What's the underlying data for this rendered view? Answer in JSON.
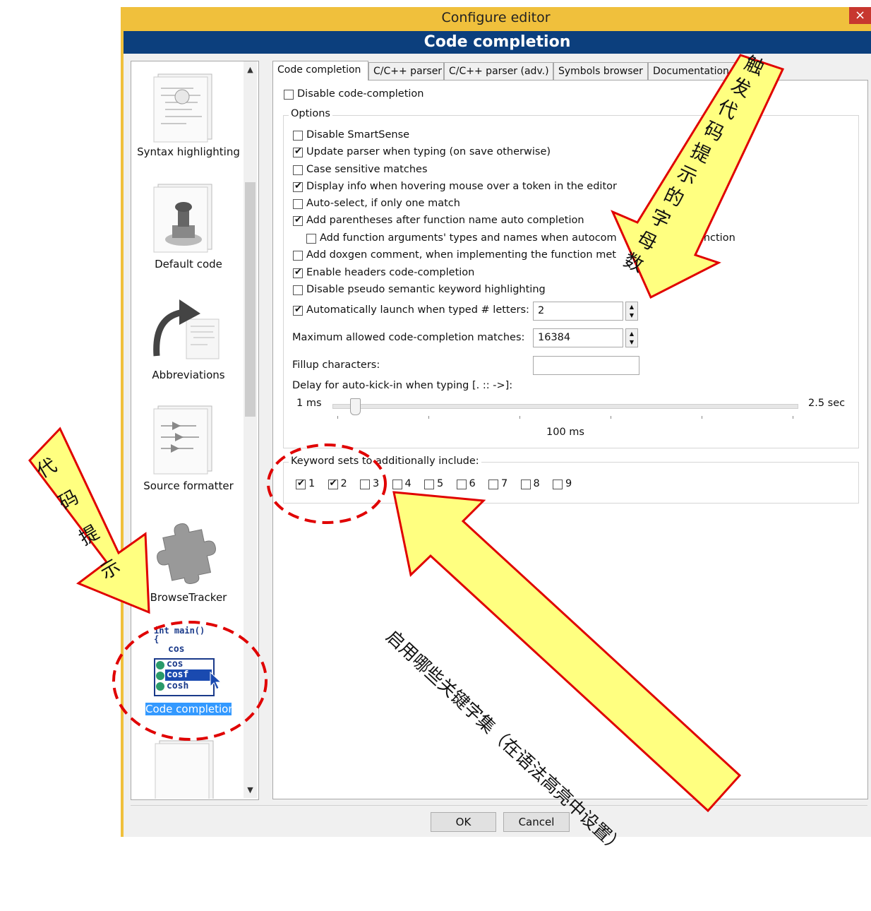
{
  "window": {
    "title": "Configure editor",
    "close_glyph": "×",
    "header": "Code completion"
  },
  "sidebar": {
    "items": [
      {
        "label": "Syntax highlighting",
        "icon": "document-icon"
      },
      {
        "label": "Default code",
        "icon": "stamp-icon"
      },
      {
        "label": "Abbreviations",
        "icon": "curved-arrow-icon"
      },
      {
        "label": "Source formatter",
        "icon": "formatter-icon"
      },
      {
        "label": "BrowseTracker",
        "icon": "puzzle-icon"
      },
      {
        "label": "Code completion",
        "icon": "code-completion-icon",
        "selected": true
      }
    ],
    "code_icon_lines": [
      "int main()",
      "{",
      "cos",
      "cos",
      "cosf",
      "cosh"
    ]
  },
  "tabs": [
    "Code completion",
    "C/C++ parser",
    "C/C++ parser (adv.)",
    "Symbols browser",
    "Documentation"
  ],
  "panel": {
    "disable_cc": {
      "label": "Disable code-completion",
      "checked": false
    },
    "options_title": "Options",
    "options": [
      {
        "label": "Disable SmartSense",
        "checked": false
      },
      {
        "label": "Update parser when typing (on save otherwise)",
        "checked": true
      },
      {
        "label": "Case sensitive matches",
        "checked": false
      },
      {
        "label": "Display info when hovering mouse over a token in the editor",
        "checked": true
      },
      {
        "label": "Auto-select, if only one match",
        "checked": false
      },
      {
        "label": "Add parentheses after function name auto completion",
        "checked": true
      },
      {
        "label": "Add function arguments' types and names when autocom",
        "label_tail": "e function",
        "checked": false
      },
      {
        "label": "Add doxgen comment, when implementing the function met",
        "checked": false
      },
      {
        "label": "Enable headers code-completion",
        "checked": true
      },
      {
        "label": "Disable pseudo semantic keyword highlighting",
        "checked": false
      }
    ],
    "auto_launch": {
      "label": "Automatically launch when typed # letters:",
      "checked": true,
      "value": "2"
    },
    "max_matches": {
      "label": "Maximum allowed code-completion matches:",
      "value": "16384"
    },
    "fillup": {
      "label": "Fillup characters:",
      "value": ""
    },
    "delay": {
      "label": "Delay for auto-kick-in when typing [. :: ->]:",
      "min": "1 ms",
      "max": "2.5 sec",
      "current": "100 ms",
      "fraction": 0.0
    },
    "keywords_title": "Keyword sets to additionally include:",
    "keyword_sets": [
      {
        "label": "1",
        "checked": true
      },
      {
        "label": "2",
        "checked": true
      },
      {
        "label": "3",
        "checked": false
      },
      {
        "label": "4",
        "checked": false
      },
      {
        "label": "5",
        "checked": false
      },
      {
        "label": "6",
        "checked": false
      },
      {
        "label": "7",
        "checked": false
      },
      {
        "label": "8",
        "checked": false
      },
      {
        "label": "9",
        "checked": false
      }
    ]
  },
  "buttons": {
    "ok": "OK",
    "cancel": "Cancel"
  },
  "annotations": {
    "left_arrow": [
      "代",
      "码",
      "提",
      "示"
    ],
    "top_arrow": [
      "触",
      "发",
      "代",
      "码",
      "提",
      "示",
      "的",
      "字",
      "母",
      "数"
    ],
    "bottom_arrow": "启用哪些关键字集（在语法高亮中设置）",
    "arrow_color": "#ffff80",
    "arrow_outline": "#e00000"
  }
}
